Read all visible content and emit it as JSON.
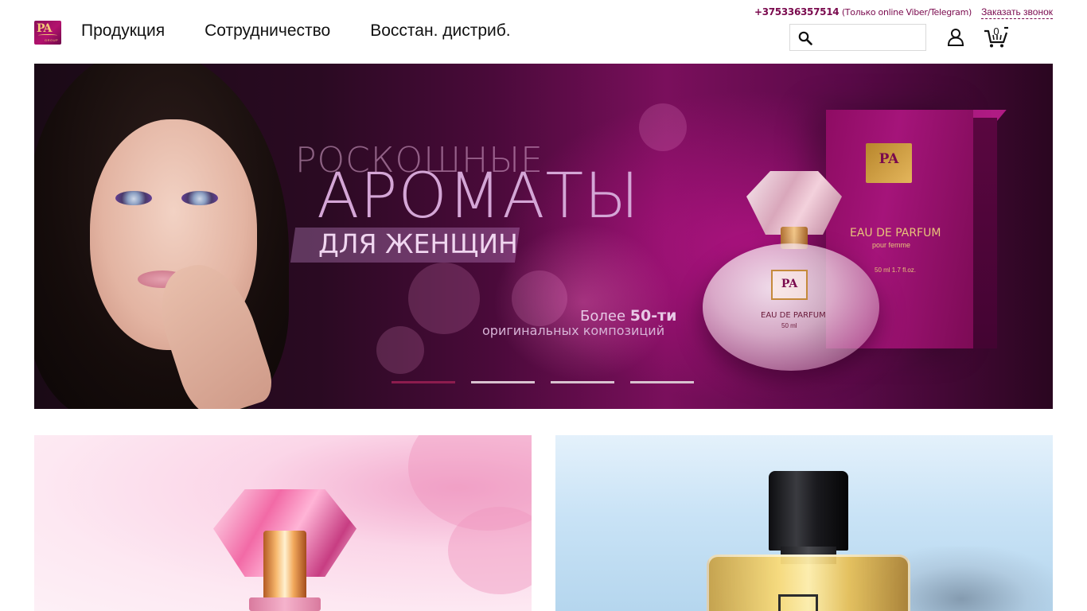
{
  "header": {
    "logo_text": "PA",
    "logo_subtext": "GROUP",
    "nav": [
      {
        "label": "Продукция"
      },
      {
        "label": "Сотрудничество"
      },
      {
        "label": "Восстан. дистриб."
      }
    ],
    "phone": "+375336357514",
    "phone_note": "(Только online Viber/Telegram)",
    "callback_label": "Заказать звонок",
    "search": {
      "value": "",
      "placeholder": ""
    },
    "cart_count": "0"
  },
  "hero": {
    "line1": "РОСКОШНЫЕ",
    "line2": "АРОМАТЫ",
    "line3": "ДЛЯ ЖЕНЩИН",
    "more_prefix": "Более ",
    "more_number": "50-ти",
    "more_line2": "оригинальных композиций",
    "box_logo": "PA",
    "box_title": "EAU DE PARFUM",
    "box_sub": "pour femme",
    "box_volume": "50 ml 1.7 fl.oz.",
    "bottle_logo": "PA",
    "bottle_title": "EAU DE PARFUM",
    "bottle_volume": "50 ml",
    "slides_total": 4,
    "active_slide": 1
  },
  "tiles": [
    {
      "name": "women-perfume-tile"
    },
    {
      "name": "men-perfume-tile"
    }
  ],
  "colors": {
    "brand": "#7a0a4e",
    "slider_active": "#8d1c4e",
    "slider_inactive": "#d8c2cf"
  },
  "icons": [
    "search-icon",
    "user-icon",
    "cart-icon"
  ]
}
